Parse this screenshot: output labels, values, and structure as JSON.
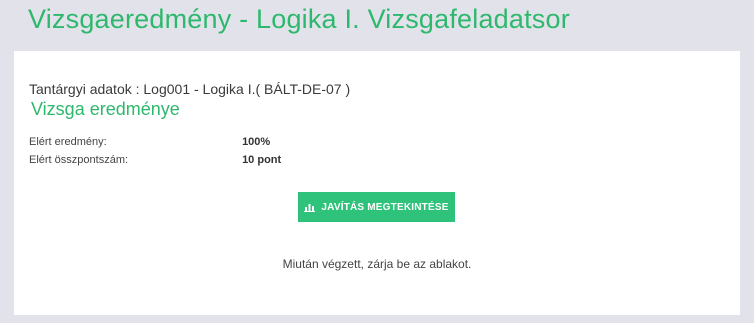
{
  "header": {
    "title": "Vizsgaeredmény - Logika I. Vizsgafeladatsor"
  },
  "subject": {
    "text": "Tantárgyi adatok : Log001 - Logika I.( BÁLT-DE-07 )"
  },
  "result": {
    "section_title": "Vizsga eredménye",
    "rows": [
      {
        "label": "Elért eredmény:",
        "value": "100%"
      },
      {
        "label": "Elért összpontszám:",
        "value": "10 pont"
      }
    ]
  },
  "actions": {
    "view_correction_label": "JAVÍTÁS MEGTEKINTÉSE",
    "view_correction_icon": "bar-chart-icon"
  },
  "footer": {
    "note": "Miután végzett, zárja be az ablakot."
  },
  "colors": {
    "accent": "#2eb86d",
    "button": "#2ec27a",
    "background": "#e2e3ea",
    "panel": "#ffffff"
  }
}
